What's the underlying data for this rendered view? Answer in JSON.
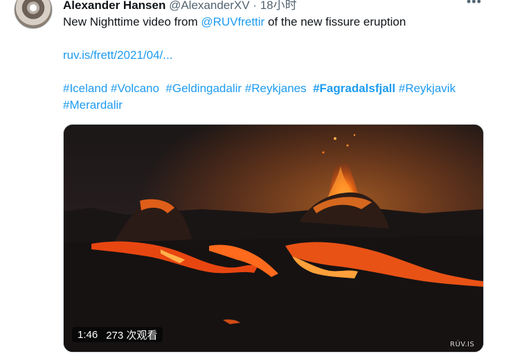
{
  "tweet": {
    "author_name": "Alexander Hansen",
    "handle": "@AlexanderXV",
    "separator": " · ",
    "time": "18小时",
    "text_before": "New Nighttime video from ",
    "mention": "@RUVfrettir",
    "text_after": " of the new fissure eruption",
    "url": "ruv.is/frett/2021/04/...",
    "hashtags_line1": [
      {
        "text": "#Iceland",
        "bold": false
      },
      {
        "text": "#Volcano",
        "bold": false
      },
      {
        "text": "#Geldingadalir",
        "bold": false
      },
      {
        "text": "#Reykjanes",
        "bold": false
      },
      {
        "text": "#Fagradalsfjall",
        "bold": true
      },
      {
        "text": "#Reykjavik",
        "bold": false
      }
    ],
    "hashtags_line2": [
      {
        "text": "#Merardalir",
        "bold": false
      }
    ]
  },
  "video": {
    "duration": "1:46",
    "views": "273 次观看",
    "watermark": "RÚV.IS"
  },
  "icons": {
    "more": "more-horizontal-icon",
    "avatar": "avatar"
  },
  "colors": {
    "link": "#1d9bf0",
    "text": "#0f1419",
    "muted": "#536471"
  }
}
